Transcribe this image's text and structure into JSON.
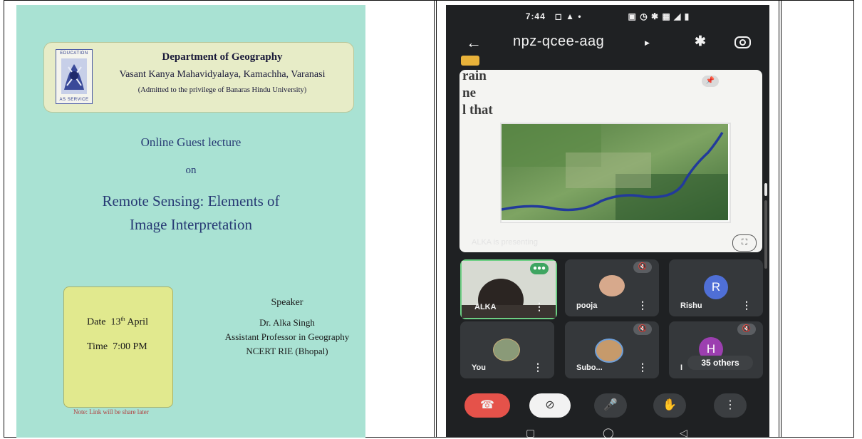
{
  "poster": {
    "logo": {
      "top_text": "EDUCATION",
      "bottom_text": "AS SERVICE"
    },
    "department": "Department of Geography",
    "college": "Vasant Kanya Mahavidyalaya, Kamachha, Varanasi",
    "affiliation": "(Admitted to the privilege of Banaras Hindu University)",
    "lecture_type": "Online Guest lecture",
    "on": "on",
    "title_line1": "Remote Sensing: Elements of",
    "title_line2": "Image Interpretation",
    "date_label": "Date",
    "date_day": "13",
    "date_sup": "th",
    "date_month": "April",
    "time_label": "Time",
    "time_value": "7:00 PM",
    "speaker_heading": "Speaker",
    "speaker_name": "Dr. Alka Singh",
    "speaker_title": "Assistant Professor in Geography",
    "speaker_org": "NCERT RIE (Bhopal)",
    "note": "Note: Link will be share later"
  },
  "phone": {
    "status_time": "7:44",
    "meeting_code": "npz-qcee-aag",
    "slide_lines": [
      "rain",
      "ne",
      "l that"
    ],
    "presenting_text": "ALKA is presenting",
    "participants": [
      {
        "name": "ALKA",
        "type": "video"
      },
      {
        "name": "pooja",
        "type": "photo",
        "muted": true
      },
      {
        "name": "Rishu",
        "type": "initial",
        "initial": "R",
        "color": "#4f6fd6",
        "muted": false
      },
      {
        "name": "You",
        "type": "photo"
      },
      {
        "name": "Subo...",
        "type": "photo",
        "muted": true
      },
      {
        "name": "I",
        "type": "initial",
        "initial": "H",
        "color": "#9c3fb0",
        "muted": true,
        "others": "35 others"
      }
    ],
    "colors": {
      "end_call": "#e5524a",
      "background": "#1f2123",
      "tile": "#35383b"
    }
  }
}
